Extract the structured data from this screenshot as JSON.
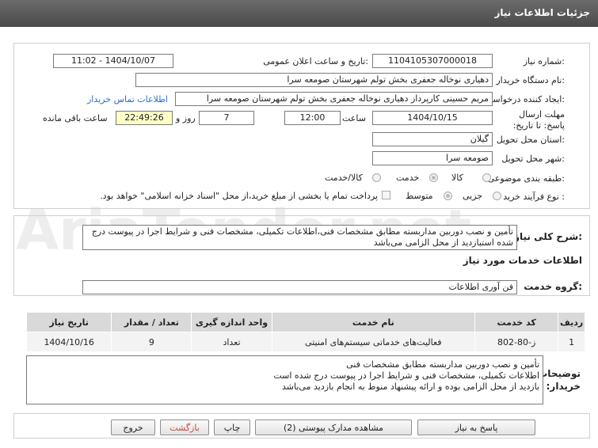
{
  "header": {
    "title": "جزئیات اطلاعات نیاز"
  },
  "watermark": "AriaTender.net",
  "fields": {
    "need_number_label": "شماره نیاز:",
    "need_number": "1104105307000018",
    "announce_label": "تاریخ و ساعت اعلان عمومی:",
    "announce_value": "1404/10/07 - 11:02",
    "buyer_label": "نام دستگاه خریدار:",
    "buyer_value": "دهیاری نوخاله جعفری بخش تولم شهرستان صومعه سرا",
    "creator_label": "ایجاد کننده درخواست:",
    "creator_value": "مریم حسینی کارپرداز دهیاری نوخاله جعفری بخش تولم شهرستان صومعه سرا",
    "contact_link": "اطلاعات تماس خریدار",
    "deadline_label": "مهلت ارسال پاسخ: تا تاریخ:",
    "deadline_date": "1404/10/15",
    "time_label": "ساعت",
    "deadline_time": "12:00",
    "days_value": "7",
    "days_label": "روز و",
    "remaining_time": "22:49:26",
    "remaining_label": "ساعت باقی مانده",
    "province_label": "استان محل تحویل:",
    "province_value": "گیلان",
    "city_label": "شهر محل تحویل:",
    "city_value": "صومعه سرا",
    "category_label": "طبقه بندی موضوعی:",
    "category_options": [
      "کالا",
      "خدمت",
      "کالا/خدمت"
    ],
    "process_label": "نوع فرآیند خرید :",
    "process_options": [
      "جزیی",
      "متوسط"
    ],
    "payment_note": "پرداخت تمام یا بخشی از مبلغ خرید،از محل \"اسناد خزانه اسلامی\" خواهد بود."
  },
  "general": {
    "label": "شرح کلی نیاز:",
    "text": "تأمین و نصب دوربین مداربسته مطابق مشخصات فنی،اطلاعات تکمیلی، مشخصات فنی و شرایط اجرا در پیوست درج شده استبازدید از محل الزامی می‌باشد"
  },
  "services": {
    "section_title": "اطلاعات خدمات مورد نیاز",
    "group_label": "گروه خدمت:",
    "group_value": "فن آوری اطلاعات",
    "columns": [
      "ردیف",
      "کد خدمت",
      "نام خدمت",
      "واحد اندازه گیری",
      "تعداد / مقدار",
      "تاریخ نیاز"
    ],
    "rows": [
      [
        "1",
        "ز-80-802",
        "فعالیت‌های خدماتی سیستم‌های امنیتی",
        "تعداد",
        "9",
        "1404/10/16"
      ]
    ]
  },
  "buyer_notes": {
    "label": "توضیحات خریدار:",
    "lines": [
      "تأمین و نصب دوربین مداربسته مطابق مشخصات فنی",
      "اطلاعات تکمیلی، مشخصات فنی و شرایط اجرا در پیوست درج شده است",
      "بازدید از محل الزامی بوده و ارائه پیشنهاد منوط به انجام بازدید می‌باشد"
    ]
  },
  "buttons": {
    "reply": "پاسخ به نیاز",
    "attachments": "مشاهده مدارک پیوستی (2)",
    "print": "چاپ",
    "back": "بازگشت",
    "exit": "خروج"
  }
}
